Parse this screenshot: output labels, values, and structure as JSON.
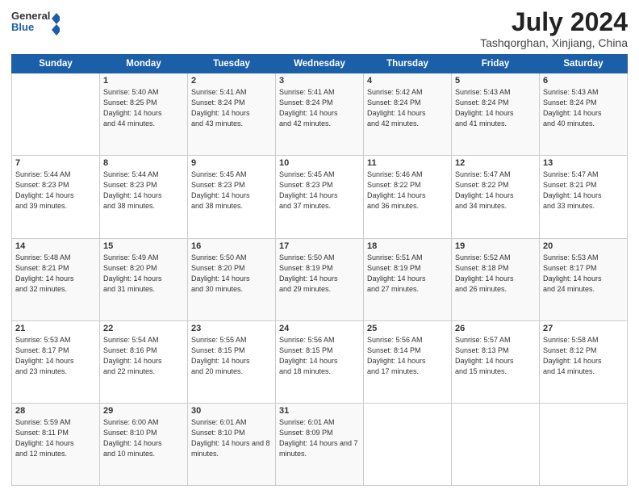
{
  "logo": {
    "line1": "General",
    "line2": "Blue"
  },
  "title": "July 2024",
  "subtitle": "Tashqorghan, Xinjiang, China",
  "days_of_week": [
    "Sunday",
    "Monday",
    "Tuesday",
    "Wednesday",
    "Thursday",
    "Friday",
    "Saturday"
  ],
  "weeks": [
    [
      {
        "day": "",
        "sunrise": "",
        "sunset": "",
        "daylight": ""
      },
      {
        "day": "1",
        "sunrise": "5:40 AM",
        "sunset": "8:25 PM",
        "daylight": "14 hours and 44 minutes."
      },
      {
        "day": "2",
        "sunrise": "5:41 AM",
        "sunset": "8:24 PM",
        "daylight": "14 hours and 43 minutes."
      },
      {
        "day": "3",
        "sunrise": "5:41 AM",
        "sunset": "8:24 PM",
        "daylight": "14 hours and 42 minutes."
      },
      {
        "day": "4",
        "sunrise": "5:42 AM",
        "sunset": "8:24 PM",
        "daylight": "14 hours and 42 minutes."
      },
      {
        "day": "5",
        "sunrise": "5:43 AM",
        "sunset": "8:24 PM",
        "daylight": "14 hours and 41 minutes."
      },
      {
        "day": "6",
        "sunrise": "5:43 AM",
        "sunset": "8:24 PM",
        "daylight": "14 hours and 40 minutes."
      }
    ],
    [
      {
        "day": "7",
        "sunrise": "5:44 AM",
        "sunset": "8:23 PM",
        "daylight": "14 hours and 39 minutes."
      },
      {
        "day": "8",
        "sunrise": "5:44 AM",
        "sunset": "8:23 PM",
        "daylight": "14 hours and 38 minutes."
      },
      {
        "day": "9",
        "sunrise": "5:45 AM",
        "sunset": "8:23 PM",
        "daylight": "14 hours and 38 minutes."
      },
      {
        "day": "10",
        "sunrise": "5:45 AM",
        "sunset": "8:23 PM",
        "daylight": "14 hours and 37 minutes."
      },
      {
        "day": "11",
        "sunrise": "5:46 AM",
        "sunset": "8:22 PM",
        "daylight": "14 hours and 36 minutes."
      },
      {
        "day": "12",
        "sunrise": "5:47 AM",
        "sunset": "8:22 PM",
        "daylight": "14 hours and 34 minutes."
      },
      {
        "day": "13",
        "sunrise": "5:47 AM",
        "sunset": "8:21 PM",
        "daylight": "14 hours and 33 minutes."
      }
    ],
    [
      {
        "day": "14",
        "sunrise": "5:48 AM",
        "sunset": "8:21 PM",
        "daylight": "14 hours and 32 minutes."
      },
      {
        "day": "15",
        "sunrise": "5:49 AM",
        "sunset": "8:20 PM",
        "daylight": "14 hours and 31 minutes."
      },
      {
        "day": "16",
        "sunrise": "5:50 AM",
        "sunset": "8:20 PM",
        "daylight": "14 hours and 30 minutes."
      },
      {
        "day": "17",
        "sunrise": "5:50 AM",
        "sunset": "8:19 PM",
        "daylight": "14 hours and 29 minutes."
      },
      {
        "day": "18",
        "sunrise": "5:51 AM",
        "sunset": "8:19 PM",
        "daylight": "14 hours and 27 minutes."
      },
      {
        "day": "19",
        "sunrise": "5:52 AM",
        "sunset": "8:18 PM",
        "daylight": "14 hours and 26 minutes."
      },
      {
        "day": "20",
        "sunrise": "5:53 AM",
        "sunset": "8:17 PM",
        "daylight": "14 hours and 24 minutes."
      }
    ],
    [
      {
        "day": "21",
        "sunrise": "5:53 AM",
        "sunset": "8:17 PM",
        "daylight": "14 hours and 23 minutes."
      },
      {
        "day": "22",
        "sunrise": "5:54 AM",
        "sunset": "8:16 PM",
        "daylight": "14 hours and 22 minutes."
      },
      {
        "day": "23",
        "sunrise": "5:55 AM",
        "sunset": "8:15 PM",
        "daylight": "14 hours and 20 minutes."
      },
      {
        "day": "24",
        "sunrise": "5:56 AM",
        "sunset": "8:15 PM",
        "daylight": "14 hours and 18 minutes."
      },
      {
        "day": "25",
        "sunrise": "5:56 AM",
        "sunset": "8:14 PM",
        "daylight": "14 hours and 17 minutes."
      },
      {
        "day": "26",
        "sunrise": "5:57 AM",
        "sunset": "8:13 PM",
        "daylight": "14 hours and 15 minutes."
      },
      {
        "day": "27",
        "sunrise": "5:58 AM",
        "sunset": "8:12 PM",
        "daylight": "14 hours and 14 minutes."
      }
    ],
    [
      {
        "day": "28",
        "sunrise": "5:59 AM",
        "sunset": "8:11 PM",
        "daylight": "14 hours and 12 minutes."
      },
      {
        "day": "29",
        "sunrise": "6:00 AM",
        "sunset": "8:10 PM",
        "daylight": "14 hours and 10 minutes."
      },
      {
        "day": "30",
        "sunrise": "6:01 AM",
        "sunset": "8:10 PM",
        "daylight": "14 hours and 8 minutes."
      },
      {
        "day": "31",
        "sunrise": "6:01 AM",
        "sunset": "8:09 PM",
        "daylight": "14 hours and 7 minutes."
      },
      {
        "day": "",
        "sunrise": "",
        "sunset": "",
        "daylight": ""
      },
      {
        "day": "",
        "sunrise": "",
        "sunset": "",
        "daylight": ""
      },
      {
        "day": "",
        "sunrise": "",
        "sunset": "",
        "daylight": ""
      }
    ]
  ]
}
